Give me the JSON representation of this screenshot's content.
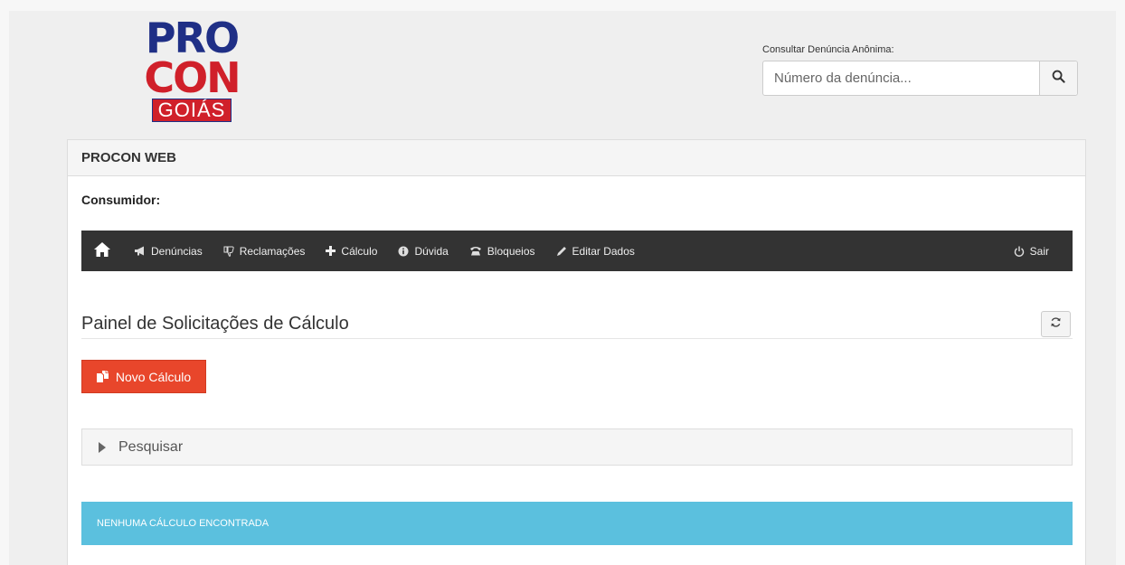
{
  "logo": {
    "line1": "PRO",
    "line2": "CON",
    "line3": "GOIÁS"
  },
  "anonymous_search": {
    "label": "Consultar Denúncia Anônima:",
    "placeholder": "Número da denúncia...",
    "value": ""
  },
  "panel": {
    "heading": "PROCON WEB",
    "consumer_label": "Consumidor:"
  },
  "navbar": {
    "items": [
      {
        "label": "Denúncias",
        "icon": "megaphone-icon"
      },
      {
        "label": "Reclamações",
        "icon": "thumbs-down-icon"
      },
      {
        "label": "Cálculo",
        "icon": "plus-icon"
      },
      {
        "label": "Dúvida",
        "icon": "info-circle-icon"
      },
      {
        "label": "Bloqueios",
        "icon": "phone-icon"
      },
      {
        "label": "Editar Dados",
        "icon": "pencil-icon"
      }
    ],
    "logout": {
      "label": "Sair",
      "icon": "power-icon"
    }
  },
  "main": {
    "title": "Painel de Solicitações de Cálculo",
    "new_button_label": "Novo Cálculo",
    "search_label": "Pesquisar",
    "empty_message": "NENHUMA CÁLCULO ENCONTRADA"
  },
  "colors": {
    "navbar_bg": "#333333",
    "primary_action": "#e8462b",
    "info_alert": "#5bc0de",
    "logo_blue": "#1f2f86",
    "logo_red": "#d0202a"
  }
}
